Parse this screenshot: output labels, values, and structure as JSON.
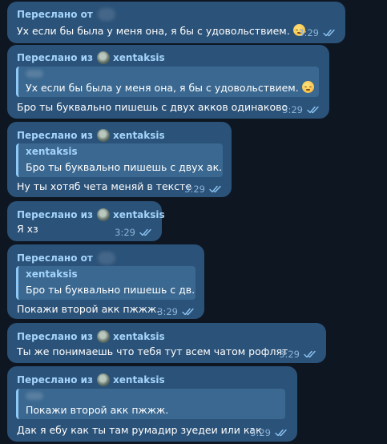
{
  "chat": {
    "messages": [
      {
        "forward_label": "Переслано от",
        "text": "Ух если бы была у меня она, я бы с удовольствием.",
        "emoji": "pensive-face",
        "time": "3:29"
      },
      {
        "forward_label": "Переслано из",
        "forward_source": "xentaksis",
        "quote_text": "Ух если бы была у меня она, я бы с удовольствием.",
        "text": "Бро ты буквально пишешь с двух акков одинаково",
        "time": "3:29"
      },
      {
        "forward_label": "Переслано из",
        "forward_source": "xentaksis",
        "quote_name": "xentaksis",
        "quote_text": "Бро ты буквально пишешь с двух ак...",
        "text": "Ну ты хотяб чета меняй в тексте",
        "time": "3:29"
      },
      {
        "forward_label": "Переслано из",
        "forward_source": "xentaksis",
        "text": "Я хз",
        "time": "3:29"
      },
      {
        "forward_label": "Переслано от",
        "quote_name": "xentaksis",
        "quote_text": "Бро ты буквально пишешь с дв...",
        "text": "Покажи второй акк пжжж.",
        "time": "3:29"
      },
      {
        "forward_label": "Переслано из",
        "forward_source": "xentaksis",
        "text": "Ты же понимаешь что тебя тут всем чатом рофлят",
        "time": "3:29"
      },
      {
        "forward_label": "Переслано из",
        "forward_source": "xentaksis",
        "quote_text": "Покажи второй акк пжжж.",
        "text": "Дак я ебу как ты там румадир зуедеи или как",
        "time": "3:29"
      }
    ]
  },
  "colors": {
    "background": "#0e1621",
    "bubble": "#2b5278",
    "accent": "#a5d4fb",
    "time": "#8cb4d8"
  },
  "icons": {
    "read_status": "double-check-icon",
    "source_avatar": "channel-avatar-icon"
  }
}
